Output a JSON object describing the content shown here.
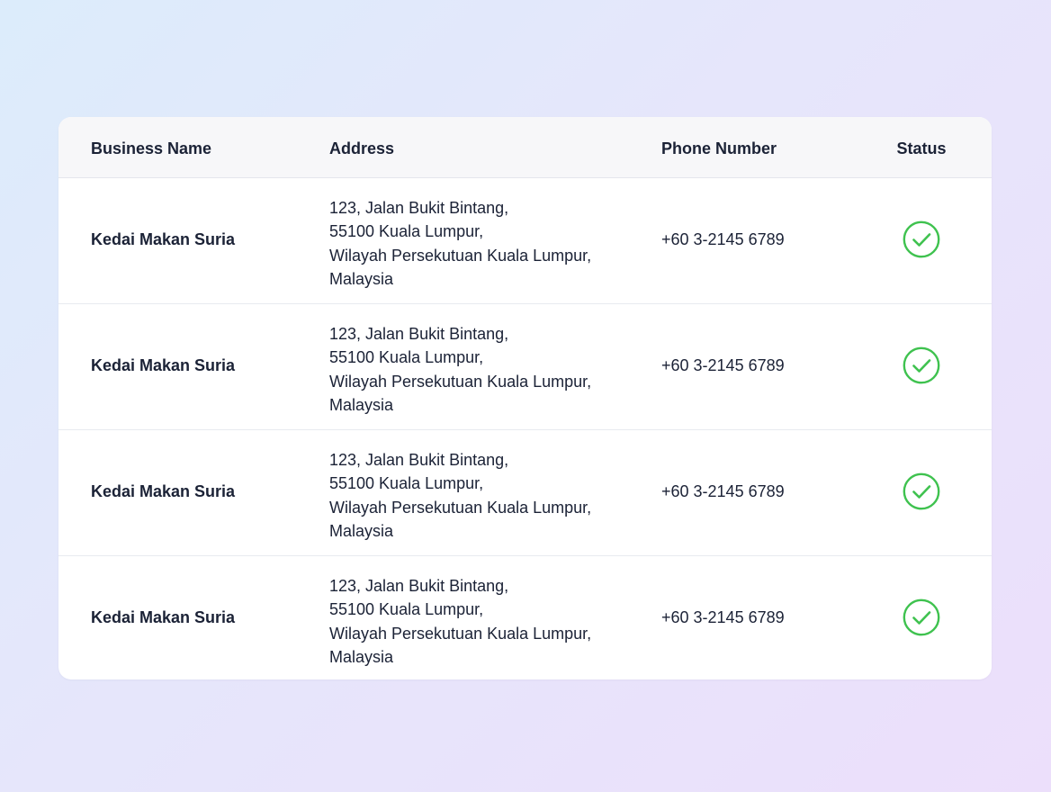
{
  "table": {
    "headers": {
      "business_name": "Business Name",
      "address": "Address",
      "phone_number": "Phone Number",
      "status": "Status"
    },
    "rows": [
      {
        "business_name": "Kedai Makan Suria",
        "address_lines": [
          "123, Jalan Bukit Bintang,",
          "55100 Kuala Lumpur,",
          "Wilayah Persekutuan Kuala Lumpur,",
          "Malaysia"
        ],
        "phone_number": "+60 3-2145 6789",
        "status_icon": "check-circle-icon"
      },
      {
        "business_name": "Kedai Makan Suria",
        "address_lines": [
          "123, Jalan Bukit Bintang,",
          "55100 Kuala Lumpur,",
          "Wilayah Persekutuan Kuala Lumpur,",
          "Malaysia"
        ],
        "phone_number": "+60 3-2145 6789",
        "status_icon": "check-circle-icon"
      },
      {
        "business_name": "Kedai Makan Suria",
        "address_lines": [
          "123, Jalan Bukit Bintang,",
          "55100 Kuala Lumpur,",
          "Wilayah Persekutuan Kuala Lumpur,",
          "Malaysia"
        ],
        "phone_number": "+60 3-2145 6789",
        "status_icon": "check-circle-icon"
      },
      {
        "business_name": "Kedai Makan Suria",
        "address_lines": [
          "123, Jalan Bukit Bintang,",
          "55100 Kuala Lumpur,",
          "Wilayah Persekutuan Kuala Lumpur,",
          "Malaysia"
        ],
        "phone_number": "+60 3-2145 6789",
        "status_icon": "check-circle-icon"
      }
    ]
  },
  "colors": {
    "status_ok": "#3fc24f",
    "text": "#1b2236",
    "header_bg": "#f7f7f9"
  }
}
